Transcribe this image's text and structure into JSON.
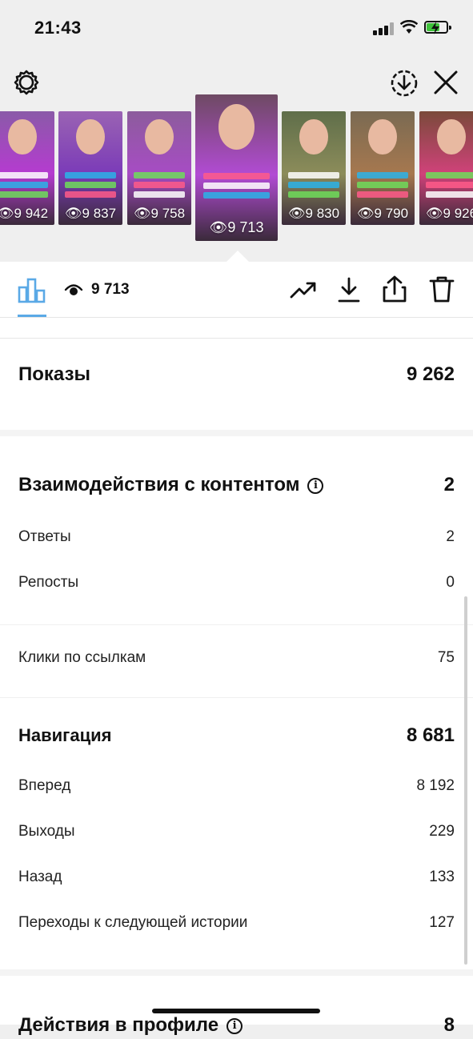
{
  "status": {
    "time": "21:43"
  },
  "stories": [
    {
      "views": "9 942",
      "bg": "#8a5aa8",
      "accent": "#b53bd0"
    },
    {
      "views": "9 837",
      "bg": "#9a63b3",
      "accent": "#7b3bb8"
    },
    {
      "views": "9 758",
      "bg": "#8c5c9c",
      "accent": "#a74cc4"
    },
    {
      "views": "9 713",
      "bg": "#6e4a63",
      "accent": "#b24bd4",
      "selected": true
    },
    {
      "views": "9 830",
      "bg": "#5f6e4a",
      "accent": "#8c8c5a"
    },
    {
      "views": "9 790",
      "bg": "#7a6a52",
      "accent": "#a6784f"
    },
    {
      "views": "9 926",
      "bg": "#7a4a3a",
      "accent": "#d0427a"
    }
  ],
  "toolbar": {
    "views": "9 713"
  },
  "impressions": {
    "label": "Показы",
    "value": "9 262"
  },
  "interactions": {
    "label": "Взаимодействия с контентом",
    "value": "2",
    "rows": [
      {
        "label": "Ответы",
        "value": "2"
      },
      {
        "label": "Репосты",
        "value": "0"
      }
    ]
  },
  "link_clicks": {
    "label": "Клики по ссылкам",
    "value": "75"
  },
  "navigation": {
    "label": "Навигация",
    "value": "8 681",
    "rows": [
      {
        "label": "Вперед",
        "value": "8 192"
      },
      {
        "label": "Выходы",
        "value": "229"
      },
      {
        "label": "Назад",
        "value": "133"
      },
      {
        "label": "Переходы к следующей истории",
        "value": "127"
      }
    ]
  },
  "profile_actions": {
    "label": "Действия в профиле",
    "value": "8"
  },
  "colors": {
    "accent_blue": "#5aa9e6",
    "battery_green": "#3ec13a"
  }
}
